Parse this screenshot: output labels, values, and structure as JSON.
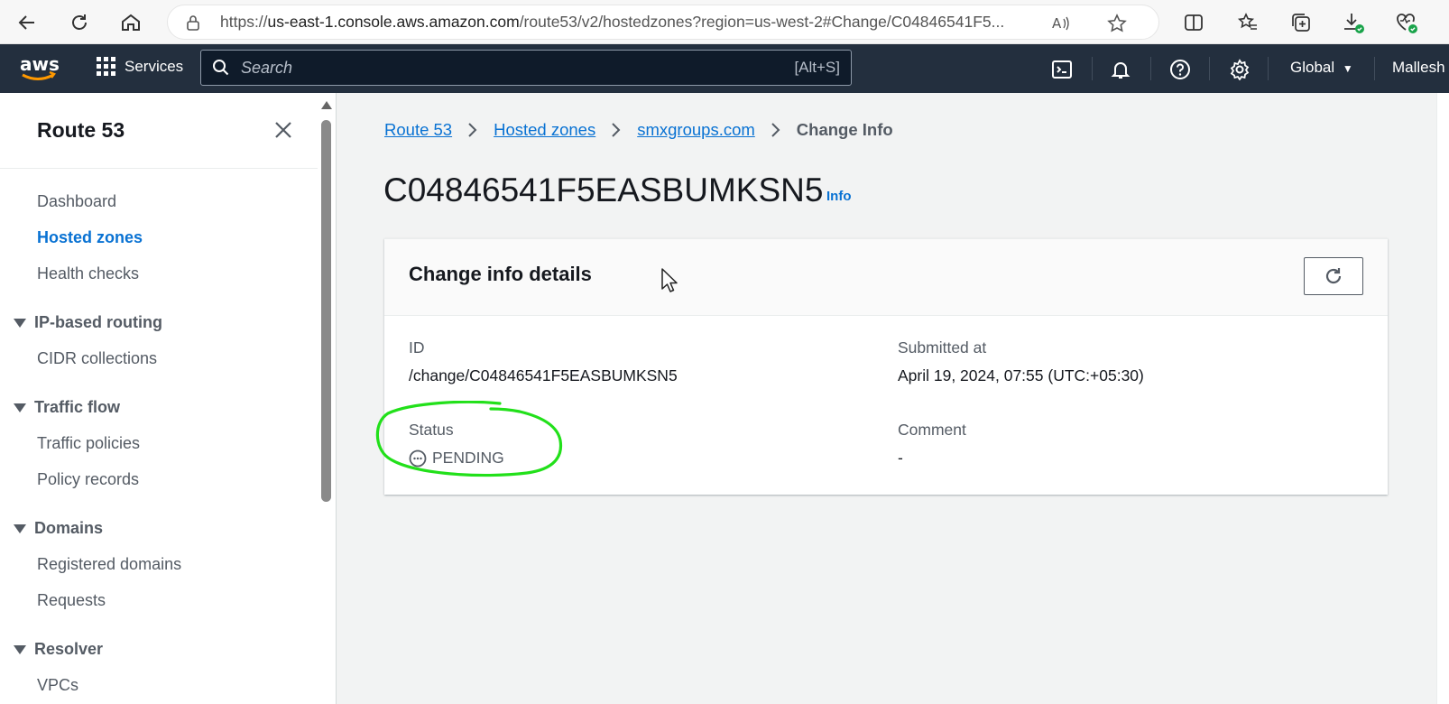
{
  "browser": {
    "url_prefix": "https://",
    "url_host": "us-east-1.console.aws.amazon.com",
    "url_path": "/route53/v2/hostedzones?region=us-west-2#Change/C04846541F5..."
  },
  "aws_nav": {
    "services_label": "Services",
    "search_placeholder": "Search",
    "search_shortcut": "[Alt+S]",
    "region_label": "Global",
    "user_label": "Mallesh"
  },
  "sidebar": {
    "title": "Route 53",
    "items": [
      {
        "label": "Dashboard"
      },
      {
        "label": "Hosted zones",
        "active": true
      },
      {
        "label": "Health checks"
      }
    ],
    "sections": [
      {
        "label": "IP-based routing",
        "items": [
          "CIDR collections"
        ]
      },
      {
        "label": "Traffic flow",
        "items": [
          "Traffic policies",
          "Policy records"
        ]
      },
      {
        "label": "Domains",
        "items": [
          "Registered domains",
          "Requests"
        ]
      },
      {
        "label": "Resolver",
        "items": [
          "VPCs"
        ]
      }
    ]
  },
  "breadcrumb": {
    "items": [
      "Route 53",
      "Hosted zones",
      "smxgroups.com"
    ],
    "current": "Change Info"
  },
  "page": {
    "title": "C04846541F5EASBUMKSN5",
    "info_link": "Info"
  },
  "panel": {
    "title": "Change info details",
    "id_label": "ID",
    "id_value": "/change/C04846541F5EASBUMKSN5",
    "submitted_label": "Submitted at",
    "submitted_value": "April 19, 2024, 07:55 (UTC:+05:30)",
    "status_label": "Status",
    "status_value": "PENDING",
    "comment_label": "Comment",
    "comment_value": "-"
  },
  "colors": {
    "link": "#0972d3",
    "nav_bg": "#232f3e",
    "annotation": "#22e01a",
    "aws_orange": "#ff9900"
  }
}
